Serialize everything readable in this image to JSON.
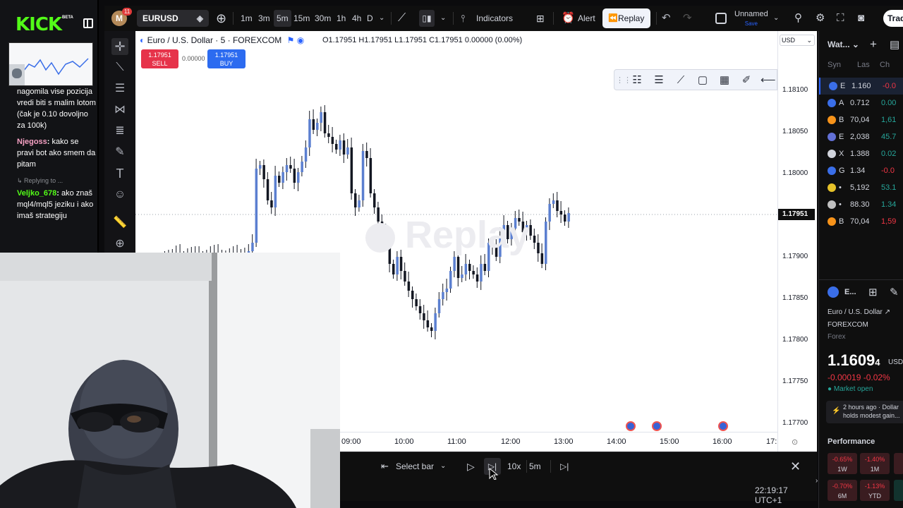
{
  "kick": {
    "logo": "KICK",
    "beta": "BETA",
    "chat": [
      {
        "user": "",
        "text": "nagomila vise pozicija vredi biti s malim lotom (čak je 0.10 dovoljno za 100k)",
        "color": "#ffffff"
      },
      {
        "user": "Njegoss",
        "text": "kako se pravi bot ako smem da pitam",
        "color": "#f7a1c4"
      },
      {
        "reply": "Replying to ..."
      },
      {
        "user": "Veljko_678",
        "text": "ako znaš mql4/mql5 jeziku i ako imaš strategiju",
        "color": "#53fc18"
      }
    ]
  },
  "topbar": {
    "avatar": "M",
    "notifications": "11",
    "symbol": "EURUSD",
    "timeframes": [
      "1m",
      "3m",
      "5m",
      "15m",
      "30m",
      "1h",
      "4h",
      "D"
    ],
    "active_timeframe": "5m",
    "indicators": "Indicators",
    "alert": "Alert",
    "replay": "Replay",
    "layout_name": "Unnamed",
    "layout_sub": "Save",
    "trade": "Trade"
  },
  "chart": {
    "title": "Euro / U.S. Dollar · 5 · FOREXCOM",
    "ohlc": "O1.17951 H1.17951 L1.17951 C1.17951 0.00000 (0.00%)",
    "sell_price": "1.17951",
    "sell_label": "SELL",
    "buy_price": "1.17951",
    "buy_label": "BUY",
    "spread": "0.00000",
    "watermark": "Replay",
    "currency": "USD",
    "price_ticks": [
      "1.18100",
      "1.18050",
      "1.18000",
      "1.17900",
      "1.17850",
      "1.17800",
      "1.17750",
      "1.17700"
    ],
    "last_price": "1.17951",
    "time_ticks": [
      "09:00",
      "10:00",
      "11:00",
      "12:00",
      "13:00",
      "14:00",
      "15:00",
      "16:00",
      "17:"
    ]
  },
  "replay_bar": {
    "select_bar": "Select bar",
    "speed": "10x",
    "interval": "5m",
    "clock": "22:19:17 UTC+1"
  },
  "right_panel": {
    "title": "Wat...",
    "columns": [
      "Syn",
      "Las",
      "Ch"
    ],
    "rows": [
      {
        "sym": "E",
        "last": "1.160",
        "chg": "-0.0",
        "dir": "down",
        "color": "#3a6ee8"
      },
      {
        "sym": "A",
        "last": "0.712",
        "chg": "0.00",
        "dir": "up",
        "color": "#3a6ee8"
      },
      {
        "sym": "B",
        "last": "70,04",
        "chg": "1,61",
        "dir": "up",
        "color": "#f7931a"
      },
      {
        "sym": "E",
        "last": "2,038",
        "chg": "45.7",
        "dir": "up",
        "color": "#6270d6"
      },
      {
        "sym": "X",
        "last": "1.388",
        "chg": "0.02",
        "dir": "up",
        "color": "#d1d4dc"
      },
      {
        "sym": "G",
        "last": "1.34",
        "chg": "-0.0",
        "dir": "down",
        "color": "#3a6ee8"
      },
      {
        "sym": "",
        "last": "5,192",
        "chg": "53.1",
        "dir": "up",
        "color": "#e6c229"
      },
      {
        "sym": "",
        "last": "88.30",
        "chg": "1.34",
        "dir": "up",
        "color": "#c0c0c0"
      },
      {
        "sym": "B",
        "last": "70,04",
        "chg": "1,59",
        "dir": "down",
        "color": "#f7931a"
      }
    ],
    "detail_title": "E...",
    "detail_name": "Euro / U.S. Dollar",
    "exchange": "FOREXCOM",
    "type": "Forex",
    "price": "1.1609",
    "price_small": "4",
    "price_currency": "USD",
    "change": "-0.00019  -0.02%",
    "market_status": "Market open",
    "news_time": "2 hours ago · Dollar",
    "news_text": "holds modest gain...",
    "performance_title": "Performance",
    "performance": [
      {
        "val": "-0.65%",
        "label": "1W"
      },
      {
        "val": "-1.40%",
        "label": "1M"
      },
      {
        "val": "-0.70%",
        "label": "6M"
      },
      {
        "val": "-1.13%",
        "label": "YTD"
      }
    ]
  }
}
